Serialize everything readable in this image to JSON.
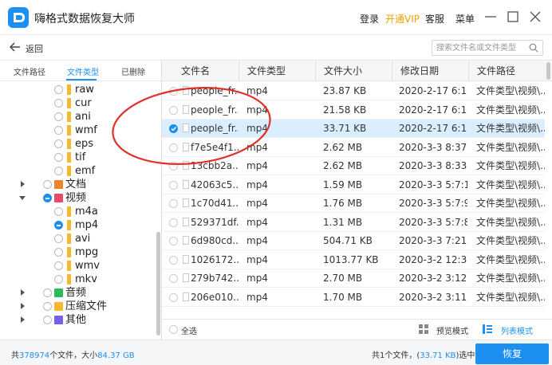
{
  "colors": {
    "accent": "#1d8ff0",
    "vip": "#f0a000",
    "annotation": "#e0312a",
    "selected_row": "#dbeeff"
  },
  "titlebar": {
    "title": "嗨格式数据恢复大师",
    "login": "登录",
    "vip": "开通VIP",
    "service": "客服",
    "menu": "菜单"
  },
  "navbar": {
    "back_label": "返回",
    "search_placeholder": "搜索文件名或文件类型"
  },
  "left_tabs": [
    {
      "label": "文件路径",
      "active": false
    },
    {
      "label": "文件类型",
      "active": true
    },
    {
      "label": "已删除",
      "active": false
    }
  ],
  "tree": [
    {
      "label": "raw",
      "level": 2,
      "kind": "folder",
      "state": "none"
    },
    {
      "label": "cur",
      "level": 2,
      "kind": "folder",
      "state": "none"
    },
    {
      "label": "ani",
      "level": 2,
      "kind": "folder",
      "state": "none"
    },
    {
      "label": "wmf",
      "level": 2,
      "kind": "folder",
      "state": "none"
    },
    {
      "label": "eps",
      "level": 2,
      "kind": "folder",
      "state": "none"
    },
    {
      "label": "tif",
      "level": 2,
      "kind": "folder",
      "state": "none"
    },
    {
      "label": "emf",
      "level": 2,
      "kind": "folder",
      "state": "none"
    },
    {
      "label": "文档",
      "level": 1,
      "kind": "doc",
      "state": "none",
      "arrow": "collapsed"
    },
    {
      "label": "视频",
      "level": 1,
      "kind": "video",
      "state": "partial",
      "arrow": "expanded"
    },
    {
      "label": "m4a",
      "level": 2,
      "kind": "folder",
      "state": "none"
    },
    {
      "label": "mp4",
      "level": 2,
      "kind": "folder",
      "state": "partial"
    },
    {
      "label": "avi",
      "level": 2,
      "kind": "folder",
      "state": "none"
    },
    {
      "label": "mpg",
      "level": 2,
      "kind": "folder",
      "state": "none"
    },
    {
      "label": "wmv",
      "level": 2,
      "kind": "folder",
      "state": "none"
    },
    {
      "label": "mkv",
      "level": 2,
      "kind": "folder",
      "state": "none"
    },
    {
      "label": "音频",
      "level": 1,
      "kind": "audio",
      "state": "none",
      "arrow": "collapsed"
    },
    {
      "label": "压缩文件",
      "level": 1,
      "kind": "zip",
      "state": "none",
      "arrow": "collapsed"
    },
    {
      "label": "其他",
      "level": 1,
      "kind": "other",
      "state": "none",
      "arrow": "collapsed"
    }
  ],
  "columns": [
    "文件名",
    "文件类型",
    "文件大小",
    "修改日期",
    "文件路径"
  ],
  "rows": [
    {
      "name": "people_fr...",
      "type": "mp4",
      "size": "23.87 KB",
      "date": "2020-2-17 6:1...",
      "path": "文件类型\\视频\\...",
      "checked": false
    },
    {
      "name": "people_fr...",
      "type": "mp4",
      "size": "21.58 KB",
      "date": "2020-2-17 6:1...",
      "path": "文件类型\\视频\\...",
      "checked": false
    },
    {
      "name": "people_fr...",
      "type": "mp4",
      "size": "33.71 KB",
      "date": "2020-2-17 6:1...",
      "path": "文件类型\\视频\\...",
      "checked": true
    },
    {
      "name": "f7e5e4f1...",
      "type": "mp4",
      "size": "2.62 MB",
      "date": "2020-3-3 8:37:...",
      "path": "文件类型\\视频\\...",
      "checked": false
    },
    {
      "name": "13cbb2a...",
      "type": "mp4",
      "size": "2.62 MB",
      "date": "2020-3-3 8:33:0",
      "path": "文件类型\\视频\\...",
      "checked": false
    },
    {
      "name": "42063c5...",
      "type": "mp4",
      "size": "1.59 MB",
      "date": "2020-3-3 5:7:10",
      "path": "文件类型\\视频\\...",
      "checked": false
    },
    {
      "name": "1c70d41...",
      "type": "mp4",
      "size": "1.76 MB",
      "date": "2020-3-3 5:7:9",
      "path": "文件类型\\视频\\...",
      "checked": false
    },
    {
      "name": "529371df...",
      "type": "mp4",
      "size": "1.31 MB",
      "date": "2020-3-3 5:7:8",
      "path": "文件类型\\视频\\...",
      "checked": false
    },
    {
      "name": "6d980cd...",
      "type": "mp4",
      "size": "504.71 KB",
      "date": "2020-3-3 7:21:8",
      "path": "文件类型\\视频\\...",
      "checked": false
    },
    {
      "name": "1026172...",
      "type": "mp4",
      "size": "1013.77 KB",
      "date": "2020-3-2 12:3...",
      "path": "文件类型\\视频\\...",
      "checked": false
    },
    {
      "name": "279b742...",
      "type": "mp4",
      "size": "2.70 MB",
      "date": "2020-3-2 3:12:...",
      "path": "文件类型\\视频\\...",
      "checked": false
    },
    {
      "name": "206e010...",
      "type": "mp4",
      "size": "1.70 MB",
      "date": "2020-3-2 3:11:...",
      "path": "文件类型\\视频\\...",
      "checked": false
    }
  ],
  "table_footer": {
    "select_all": "全选",
    "preview_mode": "预览模式",
    "list_mode": "列表模式"
  },
  "status": {
    "total_prefix": "共",
    "total_count": "378974",
    "total_mid": "个文件，大小",
    "total_size": "84.37 GB",
    "sel_prefix": "共1个文件，(",
    "sel_size": "33.71 KB",
    "sel_suffix": ")选中",
    "recover_button": "恢复"
  }
}
